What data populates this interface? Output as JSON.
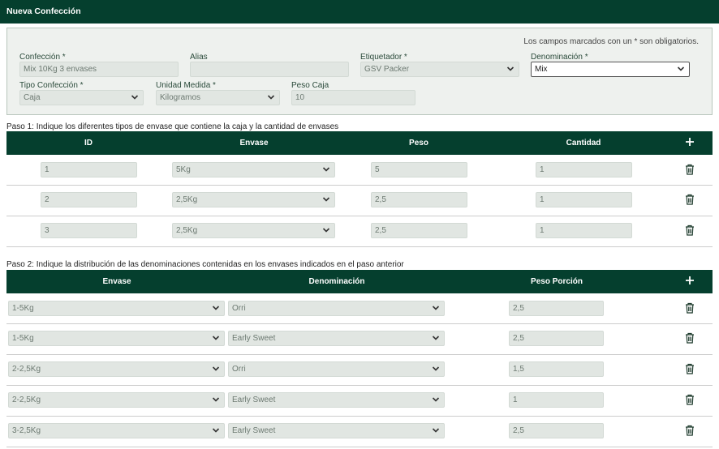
{
  "header": {
    "title": "Nueva Confección"
  },
  "form": {
    "required_note": "Los campos marcados con un * son obligatorios.",
    "confeccion": {
      "label": "Confección *",
      "value": "Mix 10Kg 3 envases"
    },
    "alias": {
      "label": "Alias",
      "value": ""
    },
    "etiquetador": {
      "label": "Etiquetador *",
      "value": "GSV Packer"
    },
    "denominacion": {
      "label": "Denominación *",
      "value": "Mix"
    },
    "tipo": {
      "label": "Tipo Confección *",
      "value": "Caja"
    },
    "unidad": {
      "label": "Unidad Medida *",
      "value": "Kilogramos"
    },
    "peso_caja": {
      "label": "Peso Caja",
      "value": "10"
    }
  },
  "step1": {
    "title": "Paso 1: Indique los diferentes tipos de envase que contiene la caja y la cantidad de envases",
    "headers": {
      "id": "ID",
      "envase": "Envase",
      "peso": "Peso",
      "cantidad": "Cantidad"
    },
    "rows": [
      {
        "id": "1",
        "envase": "5Kg",
        "peso": "5",
        "cantidad": "1"
      },
      {
        "id": "2",
        "envase": "2,5Kg",
        "peso": "2,5",
        "cantidad": "1"
      },
      {
        "id": "3",
        "envase": "2,5Kg",
        "peso": "2,5",
        "cantidad": "1"
      }
    ]
  },
  "step2": {
    "title": "Paso 2: Indique la distribución de las denominaciones contenidas en los envases indicados en el paso anterior",
    "headers": {
      "envase": "Envase",
      "denominacion": "Denominación",
      "peso": "Peso Porción"
    },
    "rows": [
      {
        "envase": "1-5Kg",
        "denominacion": "Orri",
        "peso": "2,5"
      },
      {
        "envase": "1-5Kg",
        "denominacion": "Early Sweet",
        "peso": "2,5"
      },
      {
        "envase": "2-2,5Kg",
        "denominacion": "Orri",
        "peso": "1,5"
      },
      {
        "envase": "2-2,5Kg",
        "denominacion": "Early Sweet",
        "peso": "1"
      },
      {
        "envase": "3-2,5Kg",
        "denominacion": "Early Sweet",
        "peso": "2,5"
      }
    ]
  },
  "colors": {
    "primary": "#053f2e",
    "panel": "#eef1ee",
    "field": "#e1e6e2"
  },
  "icons": {
    "add": "plus-icon",
    "delete": "trash-icon",
    "dropdown": "chevron-down-icon"
  }
}
